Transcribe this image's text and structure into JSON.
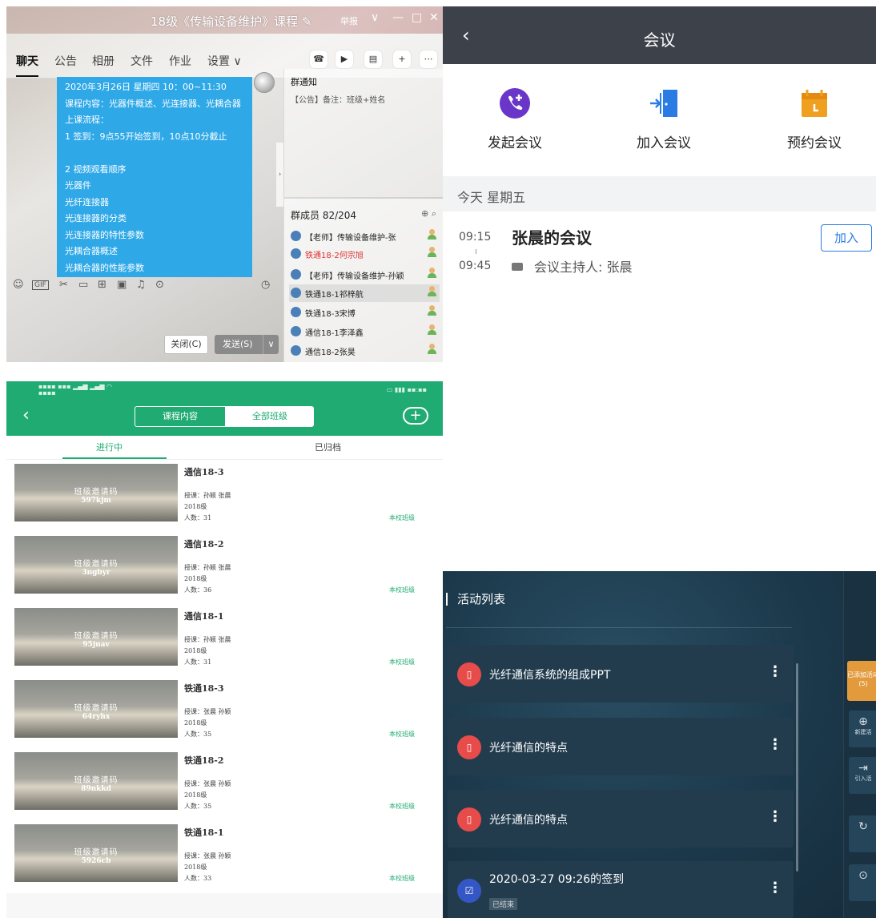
{
  "qq": {
    "title": "18级《传输设备维护》课程",
    "report": "举报",
    "tabs": [
      "聊天",
      "公告",
      "相册",
      "文件",
      "作业",
      "设置 ∨"
    ],
    "message_lines": [
      "2020年3月26日  星期四  10：00~11:30",
      "课程内容：光器件概述、光连接器、光耦合器",
      "上课流程：",
      "1 签到：9点55开始签到，10点10分截止",
      "",
      "2 视频观看顺序",
      "  光器件",
      "  光纤连接器",
      "  光连接器的分类",
      "  光连接器的特性参数",
      "  光耦合器概述",
      "  光耦合器的性能参数"
    ],
    "notice_title": "群通知",
    "notice_body": "【公告】备注：班级+姓名",
    "members_header": "群成员 82/204",
    "members": [
      {
        "name": "【老师】传输设备维护-张",
        "style": "normal"
      },
      {
        "name": "铁通18-2何宗旭",
        "style": "red"
      },
      {
        "name": "【老师】传输设备维护-孙颖",
        "style": "normal"
      },
      {
        "name": "铁通18-1祁梓航",
        "style": "hl"
      },
      {
        "name": "铁通18-3宋博",
        "style": "normal"
      },
      {
        "name": "通信18-1李泽鑫",
        "style": "normal"
      },
      {
        "name": "通信18-2张昊",
        "style": "normal"
      }
    ],
    "close_btn": "关闭(C)",
    "send_btn": "发送(S)"
  },
  "meeting": {
    "title": "会议",
    "actions": [
      {
        "label": "发起会议",
        "icon": "start-meeting-icon",
        "color": "#6a35c9"
      },
      {
        "label": "加入会议",
        "icon": "join-meeting-icon",
        "color": "#2b7be5"
      },
      {
        "label": "预约会议",
        "icon": "schedule-meeting-icon",
        "color": "#f0a020"
      }
    ],
    "date_header": "今天 星期五",
    "item": {
      "start": "09:15",
      "end": "09:45",
      "name": "张晨的会议",
      "host": "会议主持人: 张晨",
      "join": "加入"
    }
  },
  "classes": {
    "seg_left": "课程内容",
    "seg_right": "全部班级",
    "tab_active": "进行中",
    "tab_other": "已归档",
    "invite_label": "班级邀请码",
    "cards": [
      {
        "name": "通信18-3",
        "code": "597kjm",
        "teacher": "授课：孙颖 张晨",
        "term": "2018级",
        "count": "人数：31",
        "tag": "本校班级"
      },
      {
        "name": "通信18-2",
        "code": "3ngbyr",
        "teacher": "授课：孙颖 张晨",
        "term": "2018级",
        "count": "人数：36",
        "tag": "本校班级"
      },
      {
        "name": "通信18-1",
        "code": "95jnav",
        "teacher": "授课：孙颖 张晨",
        "term": "2018级",
        "count": "人数：31",
        "tag": "本校班级"
      },
      {
        "name": "铁通18-3",
        "code": "64ryhx",
        "teacher": "授课：张晨 孙颖",
        "term": "2018级",
        "count": "人数：35",
        "tag": "本校班级"
      },
      {
        "name": "铁通18-2",
        "code": "89nkkd",
        "teacher": "授课：张晨 孙颖",
        "term": "2018级",
        "count": "人数：35",
        "tag": "本校班级"
      },
      {
        "name": "铁通18-1",
        "code": "5926cb",
        "teacher": "授课：张晨 孙颖",
        "term": "2018级",
        "count": "人数：33",
        "tag": "本校班级"
      }
    ]
  },
  "activities": {
    "header": "活动列表",
    "items": [
      {
        "title": "光纤通信系统的组成PPT",
        "type": "ppt",
        "status": ""
      },
      {
        "title": "光纤通信的特点",
        "type": "ppt",
        "status": ""
      },
      {
        "title": "光纤通信的特点",
        "type": "ppt",
        "status": ""
      },
      {
        "title": "2020-03-27 09:26的签到",
        "type": "signin",
        "status": "已结束"
      }
    ],
    "added_label": "已添加活动",
    "added_count": "(5)",
    "new_label": "新建活",
    "import_label": "引入活"
  }
}
